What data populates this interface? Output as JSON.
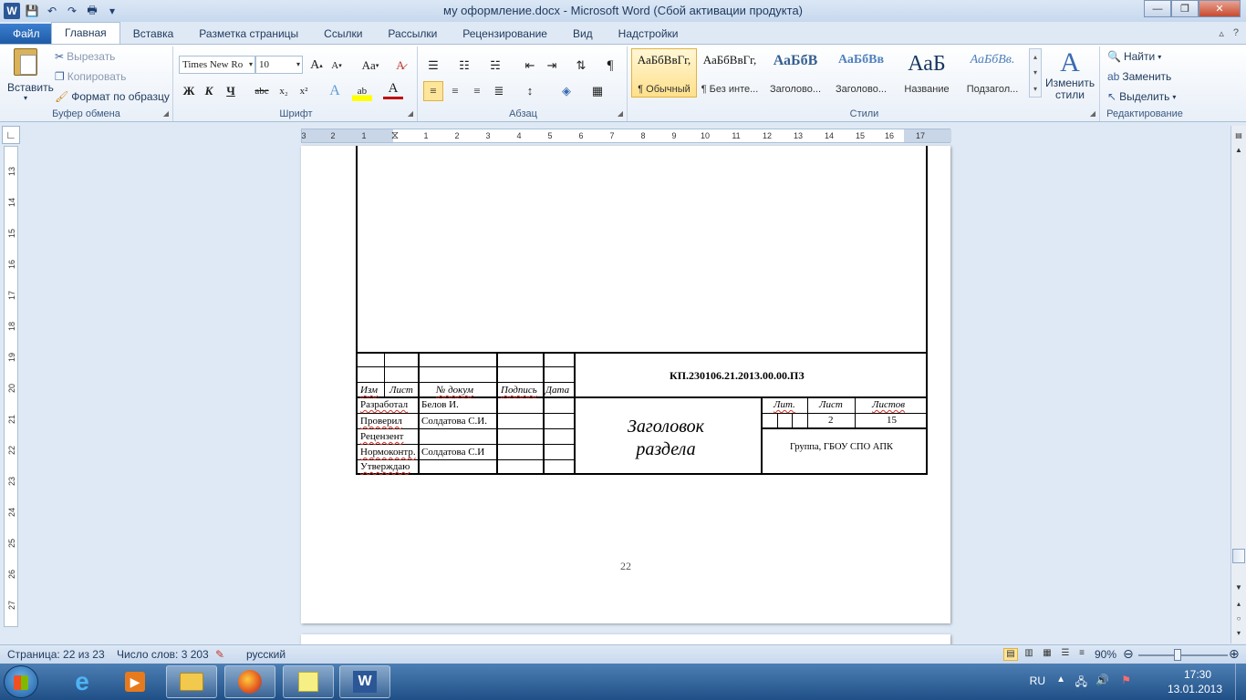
{
  "window": {
    "title": "му оформление.docx  -  Microsoft Word (Сбой активации продукта)",
    "controls": {
      "minimize": "—",
      "restore": "❐",
      "close": "✕"
    }
  },
  "qat": {
    "logo": "W",
    "save": "💾",
    "undo": "↶",
    "redo": "↷",
    "print": "🖶",
    "more": "▾"
  },
  "tabs": [
    "Файл",
    "Главная",
    "Вставка",
    "Разметка страницы",
    "Ссылки",
    "Рассылки",
    "Рецензирование",
    "Вид",
    "Надстройки"
  ],
  "tabs_right": {
    "minimize_ribbon": "▵",
    "help": "?"
  },
  "clipboard": {
    "paste": "Вставить",
    "cut": "Вырезать",
    "copy": "Копировать",
    "format_painter": "Формат по образцу",
    "label": "Буфер обмена"
  },
  "font": {
    "name": "Times New Ro",
    "size": "10",
    "grow": "A",
    "shrink": "A",
    "case": "Aa",
    "bold": "Ж",
    "italic": "К",
    "underline": "Ч",
    "strike": "abc",
    "sub": "x₂",
    "sup": "x²",
    "label": "Шрифт"
  },
  "paragraph": {
    "label": "Абзац",
    "pilcrow": "¶"
  },
  "styles": {
    "label": "Стили",
    "tiles": [
      {
        "sample": "АаБбВвГг,",
        "name": "¶ Обычный"
      },
      {
        "sample": "АаБбВвГг,",
        "name": "¶ Без инте..."
      },
      {
        "sample": "АаБбВ",
        "name": "Заголово..."
      },
      {
        "sample": "АаБбВв",
        "name": "Заголово..."
      },
      {
        "sample": "АаБ",
        "name": "Название"
      },
      {
        "sample": "АаБбВв.",
        "name": "Подзагол..."
      }
    ],
    "change": "Изменить стили"
  },
  "editing": {
    "find": "Найти",
    "replace": "Заменить",
    "select": "Выделить",
    "label": "Редактирование"
  },
  "ruler": {
    "h_ticks": [
      "3",
      "2",
      "1",
      "1",
      "2",
      "3",
      "4",
      "5",
      "6",
      "7",
      "8",
      "9",
      "10",
      "11",
      "12",
      "13",
      "14",
      "15",
      "16",
      "17"
    ],
    "v_ticks": [
      "13",
      "14",
      "15",
      "16",
      "17",
      "18",
      "19",
      "20",
      "21",
      "22",
      "23",
      "24",
      "25",
      "26",
      "27"
    ],
    "corner": "∟"
  },
  "stamp": {
    "code": "КП.230106.21.2013.00.00.ПЗ",
    "heading_line1": "Заголовок",
    "heading_line2": "раздела",
    "header_cols": [
      "Изм",
      "Лист",
      "№ докум",
      "Подпись",
      "Дата"
    ],
    "roles": [
      "Разработал",
      "Проверил",
      "Рецензент",
      "Нормоконтр.",
      "Утверждаю"
    ],
    "names": [
      "Белов И.",
      "Солдатова С.И.",
      "",
      "Солдатова С.И",
      ""
    ],
    "lit": "Лит.",
    "sheet": "Лист",
    "sheets": "Листов",
    "sheet_val": "2",
    "sheets_val": "15",
    "org": "Группа, ГБОУ СПО АПК"
  },
  "page_number": "22",
  "status": {
    "page": "Страница: 22 из 23",
    "words": "Число слов: 3 203",
    "lang": "русский",
    "zoom": "90%",
    "zoom_out": "⊖",
    "zoom_in": "⊕"
  },
  "taskbar": {
    "lang": "RU",
    "time": "17:30",
    "date": "13.01.2013"
  }
}
